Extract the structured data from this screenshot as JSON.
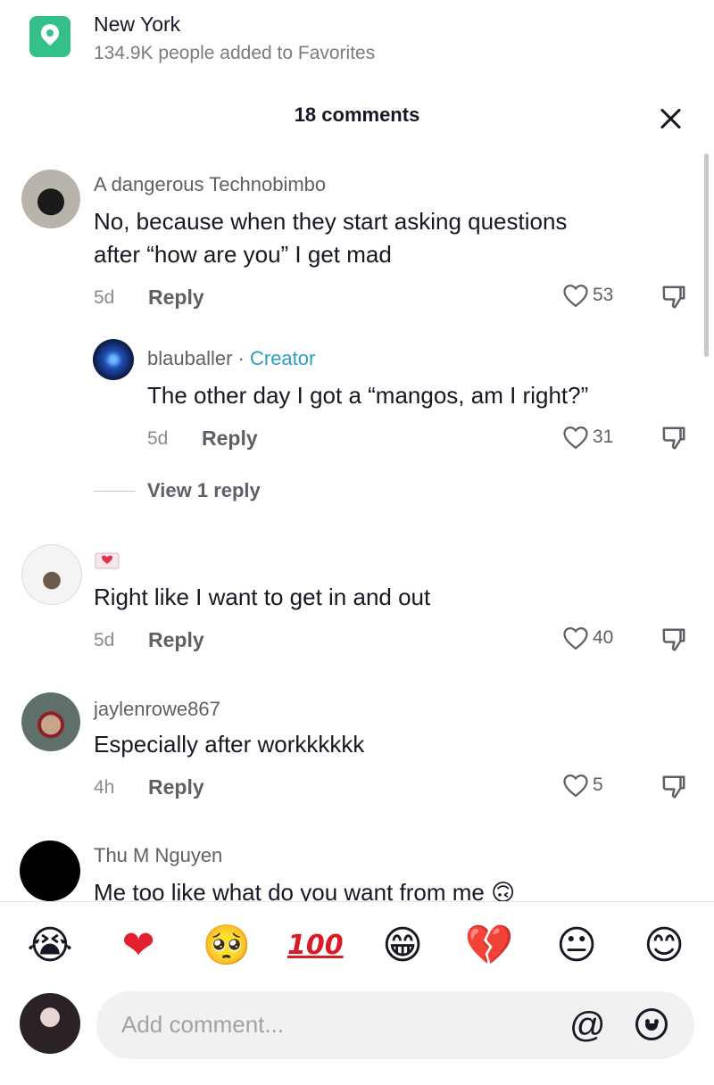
{
  "location": {
    "name": "New York",
    "subtitle": "134.9K people added to Favorites",
    "icon": "location-pin-icon"
  },
  "header": {
    "title": "18 comments",
    "close_icon": "close-icon"
  },
  "comments": [
    {
      "username": "A dangerous Technobimbo",
      "text_line1": "No, because when they start asking questions",
      "text_line2": "after “how are you” I get mad",
      "time": "5d",
      "reply": "Reply",
      "likes": "53",
      "avatar_icon": "user-avatar"
    },
    {
      "username": "blauballer",
      "separator": "·",
      "badge": "Creator",
      "text": "The other day I got a “mangos, am I right?”",
      "time": "5d",
      "reply": "Reply",
      "likes": "31",
      "view_replies": "View 1 reply",
      "avatar_icon": "creator-avatar"
    },
    {
      "username": "",
      "username_icon": "heart-envelope-icon",
      "text": "Right like I want to get in and out",
      "time": "5d",
      "reply": "Reply",
      "likes": "40",
      "avatar_icon": "hello-kitty-avatar"
    },
    {
      "username": "jaylenrowe867",
      "text": "Especially after workkkkkk",
      "time": "4h",
      "reply": "Reply",
      "likes": "5",
      "avatar_icon": "user-avatar"
    },
    {
      "username": "Thu M Nguyen",
      "text": "Me too like what do you want from me",
      "trailing_emoji": "🙃",
      "avatar_icon": "black-avatar"
    }
  ],
  "emoji_bar": [
    {
      "glyph": "😭",
      "name": "loudly-crying-emoji"
    },
    {
      "glyph": "❤",
      "name": "red-heart-emoji"
    },
    {
      "glyph": "🥺",
      "name": "pleading-face-emoji"
    },
    {
      "glyph": "100",
      "name": "hundred-points-emoji"
    },
    {
      "glyph": "😁",
      "name": "grinning-emoji"
    },
    {
      "glyph": "💔",
      "name": "broken-heart-emoji"
    },
    {
      "glyph": "😐",
      "name": "neutral-face-emoji"
    },
    {
      "glyph": "😊",
      "name": "smiling-face-emoji"
    }
  ],
  "input": {
    "placeholder": "Add comment...",
    "mention": "@",
    "emoji_icon": "emoji-picker-icon"
  },
  "colors": {
    "location_green": "#35c08a",
    "creator_blue": "#2a9fc3",
    "text_primary": "#161823",
    "text_secondary": "#5e6066"
  }
}
